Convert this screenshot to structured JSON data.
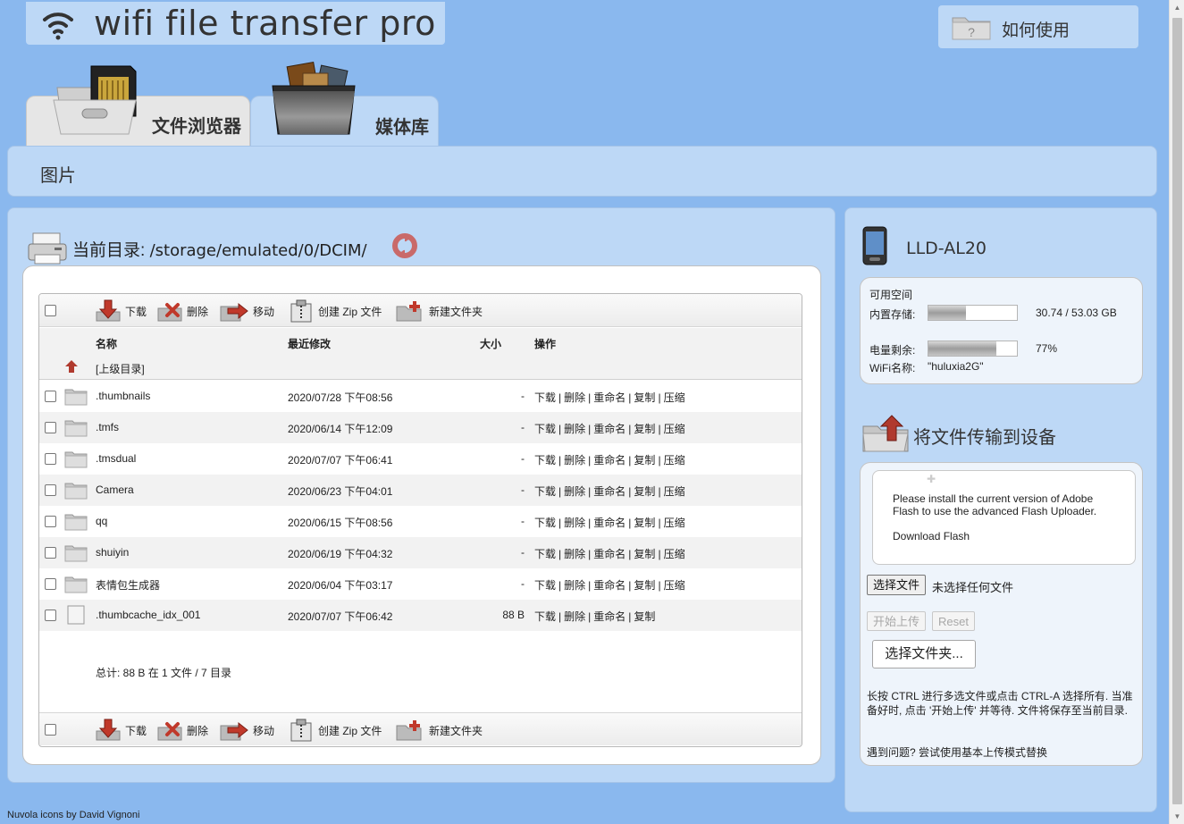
{
  "app": {
    "title": "wifi file transfer pro",
    "help_label": "如何使用"
  },
  "tabs": [
    {
      "label": "文件浏览器",
      "active": false
    },
    {
      "label": "媒体库",
      "active": true
    }
  ],
  "breadcrumb": "图片",
  "directory": {
    "label": "当前目录: ",
    "path": "/storage/emulated/0/DCIM/"
  },
  "toolbar": {
    "download": "下载",
    "delete": "删除",
    "move": "移动",
    "zip": "创建 Zip 文件",
    "new_folder": "新建文件夹"
  },
  "table": {
    "headers": {
      "name": "名称",
      "modified": "最近修改",
      "size": "大小",
      "actions": "操作"
    },
    "parent_label": "[上级目录]",
    "rows": [
      {
        "name": ".thumbnails",
        "date": "2020/07/28 下午08:56",
        "size": "-",
        "type": "folder"
      },
      {
        "name": ".tmfs",
        "date": "2020/06/14 下午12:09",
        "size": "-",
        "type": "folder"
      },
      {
        "name": ".tmsdual",
        "date": "2020/07/07 下午06:41",
        "size": "-",
        "type": "folder"
      },
      {
        "name": "Camera",
        "date": "2020/06/23 下午04:01",
        "size": "-",
        "type": "folder"
      },
      {
        "name": "qq",
        "date": "2020/06/15 下午08:56",
        "size": "-",
        "type": "folder"
      },
      {
        "name": "shuiyin",
        "date": "2020/06/19 下午04:32",
        "size": "-",
        "type": "folder"
      },
      {
        "name": "表情包生成器",
        "date": "2020/06/04 下午03:17",
        "size": "-",
        "type": "folder"
      },
      {
        "name": ".thumbcache_idx_001",
        "date": "2020/07/07 下午06:42",
        "size": "88 B",
        "type": "file"
      }
    ],
    "actions": {
      "download": "下载",
      "delete": "删除",
      "rename": "重命名",
      "copy": "复制",
      "compress": "压缩"
    },
    "totals": "总计: 88 B 在 1 文件 / 7 目录"
  },
  "device": {
    "name": "LLD-AL20",
    "free_space_label": "可用空间",
    "internal_label": "内置存储:",
    "internal_value": "30.74 / 53.03 GB",
    "internal_fraction": 0.42,
    "battery_label": "电量剩余:",
    "battery_value": "77%",
    "battery_fraction": 0.77,
    "wifi_label": "WiFi名称:",
    "wifi_value": "\"huluxia2G\""
  },
  "upload": {
    "title": "将文件传输到设备",
    "flash_message": "Please install the current version of Adobe Flash to use the advanced Flash Uploader.",
    "flash_link": "Download Flash",
    "choose_file": "选择文件",
    "no_file": "未选择任何文件",
    "start_upload": "开始上传",
    "reset": "Reset",
    "choose_folder": "选择文件夹...",
    "hint": "长按 CTRL 进行多选文件或点击 CTRL-A 选择所有. 当准备好时, 点击 '开始上传' 并等待. 文件将保存至当前目录.",
    "problem": "遇到问题? 尝试使用基本上传模式替换"
  },
  "footer": {
    "credit": "Nuvola icons by David Vignoni"
  },
  "colors": {
    "background": "#8ab8ee",
    "panel": "#bdd8f6",
    "row_alt": "#f2f2f2"
  }
}
